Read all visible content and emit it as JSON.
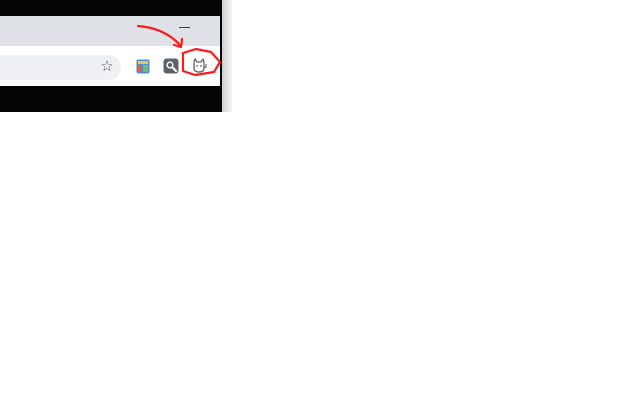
{
  "window": {
    "minimize_label": "–"
  },
  "toolbar": {
    "star_glyph": "☆",
    "extensions": [
      {
        "icon": "colorful-tile-icon",
        "color": "#4a90c9"
      },
      {
        "icon": "magnifier-icon",
        "color": "#5f6368"
      },
      {
        "icon": "cat-extension-icon",
        "color": "#5f6368"
      }
    ]
  },
  "annotation": {
    "color": "#ff1a1a",
    "marks": [
      "arrow-icon",
      "circle-highlight"
    ]
  }
}
